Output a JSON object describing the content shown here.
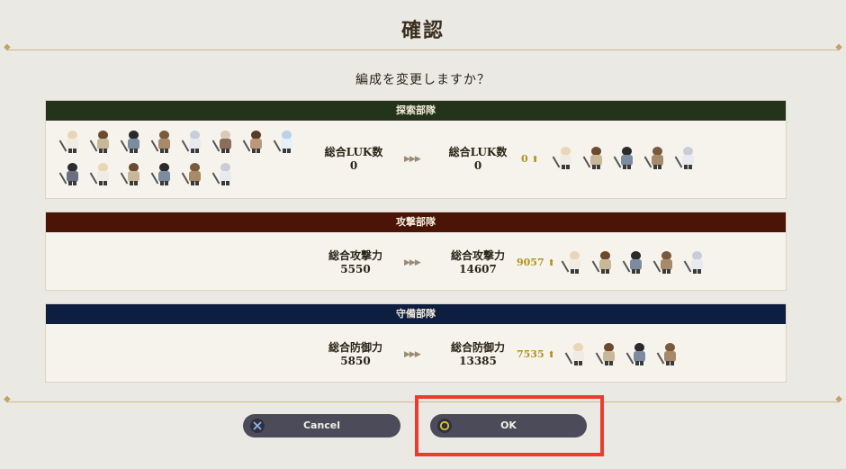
{
  "dialog": {
    "title": "確認",
    "question": "編成を変更しますか？"
  },
  "colors": {
    "exploration_header": "#24341a",
    "attack_header": "#4a1506",
    "defense_header": "#0e1e40",
    "gain": "#b39224",
    "highlight": "#ee3b2f"
  },
  "exploration": {
    "header": "探索部隊",
    "before_label": "総合LUK数",
    "before_value": "0",
    "after_label": "総合LUK数",
    "after_value": "0",
    "gain": "0",
    "gain_icon": "arrow-up-icon"
  },
  "attack": {
    "header": "攻撃部隊",
    "before_label": "総合攻撃力",
    "before_value": "5550",
    "after_label": "総合攻撃力",
    "after_value": "14607",
    "gain": "9057",
    "gain_icon": "arrow-up-icon"
  },
  "defense": {
    "header": "守備部隊",
    "before_label": "総合防御力",
    "before_value": "5850",
    "after_label": "総合防御力",
    "after_value": "13385",
    "gain": "7535",
    "gain_icon": "arrow-up-icon"
  },
  "arrows_icon": "triple-chevron-right-icon",
  "buttons": {
    "cancel_label": "Cancel",
    "cancel_icon": "cross-button-icon",
    "ok_label": "OK",
    "ok_icon": "circle-button-icon"
  }
}
